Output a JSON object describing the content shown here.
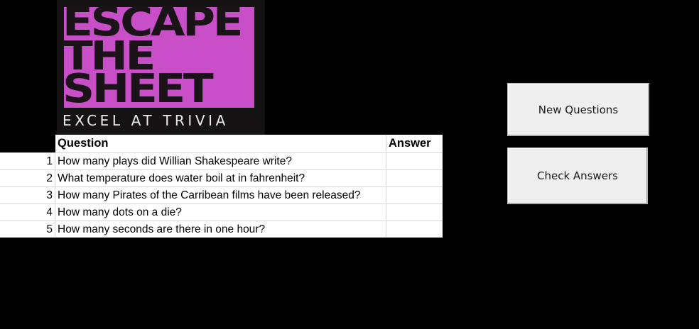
{
  "logo": {
    "line1": "ESCAPE",
    "line2": "THE",
    "line3": "SHEET",
    "tagline": "EXCEL AT TRIVIA",
    "accent_color": "#c94fc9"
  },
  "sheet": {
    "headers": {
      "question": "Question",
      "answer": "Answer"
    },
    "rows": [
      {
        "num": "1",
        "question": "How many plays did Willian Shakespeare write?",
        "answer": ""
      },
      {
        "num": "2",
        "question": "What temperature does water boil at in fahrenheit?",
        "answer": ""
      },
      {
        "num": "3",
        "question": "How many Pirates of the Carribean films have been released?",
        "answer": ""
      },
      {
        "num": "4",
        "question": "How many dots on a die?",
        "answer": ""
      },
      {
        "num": "5",
        "question": "How many seconds are there in one hour?",
        "answer": ""
      }
    ]
  },
  "buttons": {
    "new_questions": "New Questions",
    "check_answers": "Check Answers"
  }
}
